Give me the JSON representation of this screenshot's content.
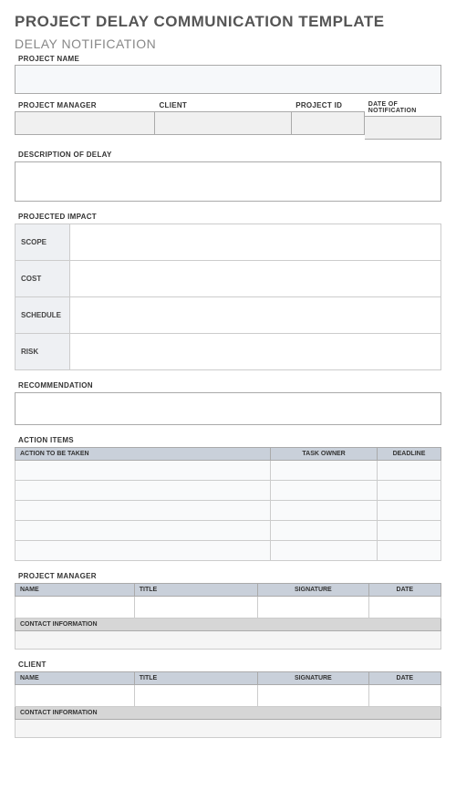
{
  "header": {
    "main_title": "PROJECT DELAY COMMUNICATION TEMPLATE",
    "subtitle": "DELAY NOTIFICATION"
  },
  "project_name": {
    "label": "PROJECT NAME",
    "value": ""
  },
  "meta_row": {
    "project_manager": {
      "label": "PROJECT MANAGER",
      "value": ""
    },
    "client": {
      "label": "CLIENT",
      "value": ""
    },
    "project_id": {
      "label": "PROJECT ID",
      "value": ""
    },
    "date_of_notification": {
      "label": "DATE OF NOTIFICATION",
      "value": ""
    }
  },
  "description": {
    "label": "DESCRIPTION OF DELAY",
    "value": ""
  },
  "impact": {
    "label": "PROJECTED IMPACT",
    "rows": [
      {
        "label": "SCOPE",
        "value": ""
      },
      {
        "label": "COST",
        "value": ""
      },
      {
        "label": "SCHEDULE",
        "value": ""
      },
      {
        "label": "RISK",
        "value": ""
      }
    ]
  },
  "recommendation": {
    "label": "RECOMMENDATION",
    "value": ""
  },
  "action_items": {
    "label": "ACTION ITEMS",
    "headers": {
      "action": "ACTION TO BE TAKEN",
      "owner": "TASK OWNER",
      "deadline": "DEADLINE"
    },
    "rows": [
      {
        "action": "",
        "owner": "",
        "deadline": ""
      },
      {
        "action": "",
        "owner": "",
        "deadline": ""
      },
      {
        "action": "",
        "owner": "",
        "deadline": ""
      },
      {
        "action": "",
        "owner": "",
        "deadline": ""
      },
      {
        "action": "",
        "owner": "",
        "deadline": ""
      }
    ]
  },
  "pm_signoff": {
    "label": "PROJECT MANAGER",
    "headers": {
      "name": "NAME",
      "title": "TITLE",
      "signature": "SIGNATURE",
      "date": "DATE"
    },
    "row": {
      "name": "",
      "title": "",
      "signature": "",
      "date": ""
    },
    "contact_label": "CONTACT INFORMATION",
    "contact_value": ""
  },
  "client_signoff": {
    "label": "CLIENT",
    "headers": {
      "name": "NAME",
      "title": "TITLE",
      "signature": "SIGNATURE",
      "date": "DATE"
    },
    "row": {
      "name": "",
      "title": "",
      "signature": "",
      "date": ""
    },
    "contact_label": "CONTACT INFORMATION",
    "contact_value": ""
  }
}
